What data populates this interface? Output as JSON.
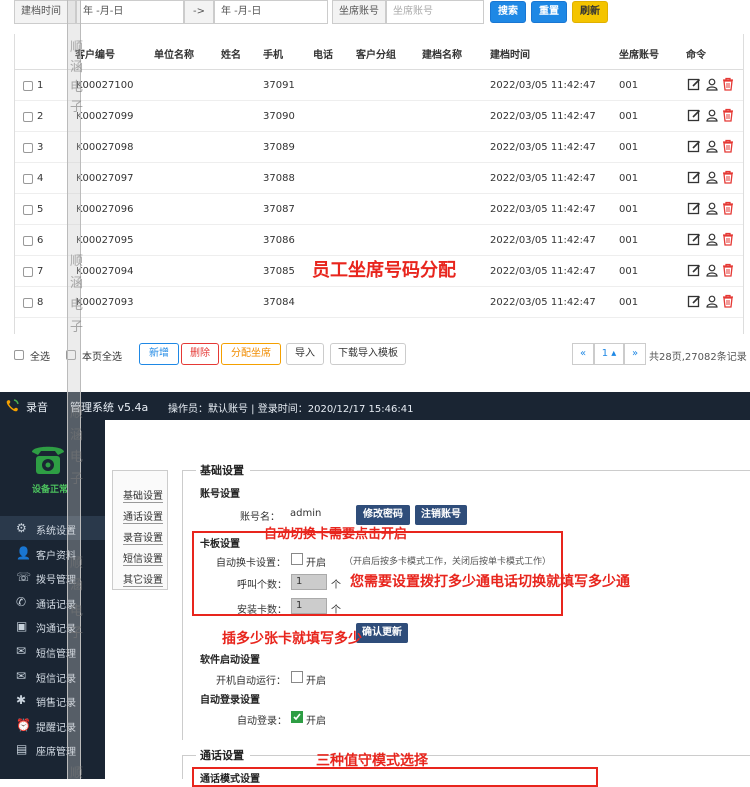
{
  "filter": {
    "label": "建档时间",
    "date_from": "年 -月-日",
    "arrow": "->",
    "date_to": "年 -月-日",
    "seat_label": "坐席账号",
    "seat_placeholder": "坐席账号",
    "search_btn": "搜索",
    "reset_btn": "重置",
    "refresh_btn": "刷新"
  },
  "table": {
    "headers": [
      "客户编号",
      "单位名称",
      "姓名",
      "手机",
      "电话",
      "客户分组",
      "建档名称",
      "建档时间",
      "坐席账号",
      "命令"
    ],
    "rows": [
      {
        "idx": "1",
        "id": "K00027100",
        "phone": "37091",
        "time": "2022/03/05 11:42:47",
        "seat": "001"
      },
      {
        "idx": "2",
        "id": "K00027099",
        "phone": "37090",
        "time": "2022/03/05 11:42:47",
        "seat": "001"
      },
      {
        "idx": "3",
        "id": "K00027098",
        "phone": "37089",
        "time": "2022/03/05 11:42:47",
        "seat": "001"
      },
      {
        "idx": "4",
        "id": "K00027097",
        "phone": "37088",
        "time": "2022/03/05 11:42:47",
        "seat": "001"
      },
      {
        "idx": "5",
        "id": "K00027096",
        "phone": "37087",
        "time": "2022/03/05 11:42:47",
        "seat": "001"
      },
      {
        "idx": "6",
        "id": "K00027095",
        "phone": "37086",
        "time": "2022/03/05 11:42:47",
        "seat": "001"
      },
      {
        "idx": "7",
        "id": "K00027094",
        "phone": "37085",
        "time": "2022/03/05 11:42:47",
        "seat": "001"
      },
      {
        "idx": "8",
        "id": "K00027093",
        "phone": "37084",
        "time": "2022/03/05 11:42:47",
        "seat": "001"
      }
    ]
  },
  "bottom_bar": {
    "select_all": "全选",
    "select_page": "本页全选",
    "add_btn": "新增",
    "delete_btn": "删除",
    "assign_btn": "分配坐席",
    "import_btn": "导入",
    "template_btn": "下载导入模板",
    "prev": "«",
    "page": "1",
    "next": "»",
    "summary": "共28页,27082条记录"
  },
  "watermark": [
    "顺",
    "涵",
    "电",
    "子"
  ],
  "annotations": {
    "seat_assign": "员工坐席号码分配",
    "auto_switch": "自动切换卡需要点击开启",
    "calls_count": "您需要设置拨打多少通电话切换就填写多少通",
    "cards_count": "插多少张卡就填写多少",
    "three_modes": "三种值守模式选择"
  },
  "app": {
    "title": "录音",
    "title_rest": "管理系统 v5.4a",
    "operator": "操作员：默认账号 | 登录时间：2020/12/17 15:46:41",
    "device_status": "设备正常",
    "sidebar": [
      {
        "label": "系统设置",
        "icon": "gear-icon"
      },
      {
        "label": "客户资料",
        "icon": "contacts-icon"
      },
      {
        "label": "拨号管理",
        "icon": "dial-icon"
      },
      {
        "label": "通话记录",
        "icon": "phone-icon"
      },
      {
        "label": "沟通记录",
        "icon": "notes-icon"
      },
      {
        "label": "短信管理",
        "icon": "sms-icon"
      },
      {
        "label": "短信记录",
        "icon": "sms-log-icon"
      },
      {
        "label": "销售记录",
        "icon": "sales-icon"
      },
      {
        "label": "提醒记录",
        "icon": "bell-icon"
      },
      {
        "label": "座席管理",
        "icon": "seat-icon"
      }
    ],
    "tabs": [
      "基础设置",
      "通话设置",
      "录音设置",
      "短信设置",
      "其它设置"
    ],
    "basic": {
      "title": "基础设置",
      "account_title": "账号设置",
      "account_label": "账号名：",
      "account_value": "admin",
      "change_pwd": "修改密码",
      "logout": "注销账号",
      "card_title": "卡板设置",
      "auto_switch_label": "自动换卡设置：",
      "auto_switch_on": "开启",
      "auto_switch_hint": "（开启后按多卡模式工作，关闭后按单卡模式工作）",
      "calls_label": "呼叫个数：",
      "calls_value": "1",
      "calls_unit": "个",
      "cards_label": "安装卡数：",
      "cards_value": "1",
      "cards_unit": "个",
      "update_btn": "确认更新",
      "boot_title": "软件启动设置",
      "boot_label": "开机自动运行：",
      "boot_on": "开启",
      "login_title": "自动登录设置",
      "login_label": "自动登录：",
      "login_on": "开启"
    },
    "call": {
      "title": "通话设置",
      "mode_title": "通话模式设置"
    }
  }
}
